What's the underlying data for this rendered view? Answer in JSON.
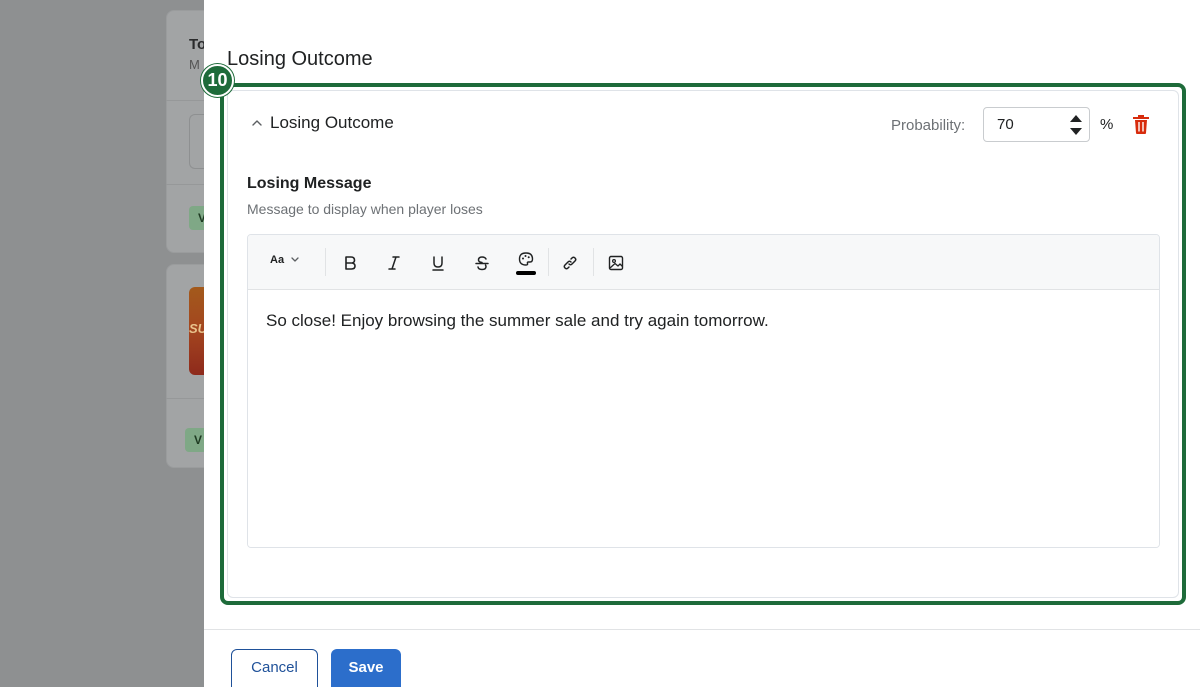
{
  "background": {
    "card_title": "To",
    "card_subtitle": "M",
    "badge_1": "V",
    "badge_2": "V",
    "image_text": "SU"
  },
  "drawer": {
    "title": "Losing Outcome",
    "annotation_number": "10"
  },
  "outcome": {
    "header_label": "Losing Outcome",
    "probability_label": "Probability:",
    "probability_value": "70",
    "percent_symbol": "%",
    "field_label": "Losing Message",
    "field_help": "Message to display when player loses",
    "toolbar": {
      "font_size_label": "Aa",
      "icons": [
        "bold-icon",
        "italic-icon",
        "underline-icon",
        "strikethrough-icon",
        "palette-icon",
        "link-icon",
        "image-icon"
      ]
    },
    "message": "So close! Enjoy browsing the summer sale and try again tomorrow."
  },
  "footer": {
    "cancel_label": "Cancel",
    "save_label": "Save"
  },
  "colors": {
    "highlight_green": "#1e6b3a",
    "primary_blue": "#2c6ecb",
    "delete_red": "#d72c0d"
  }
}
